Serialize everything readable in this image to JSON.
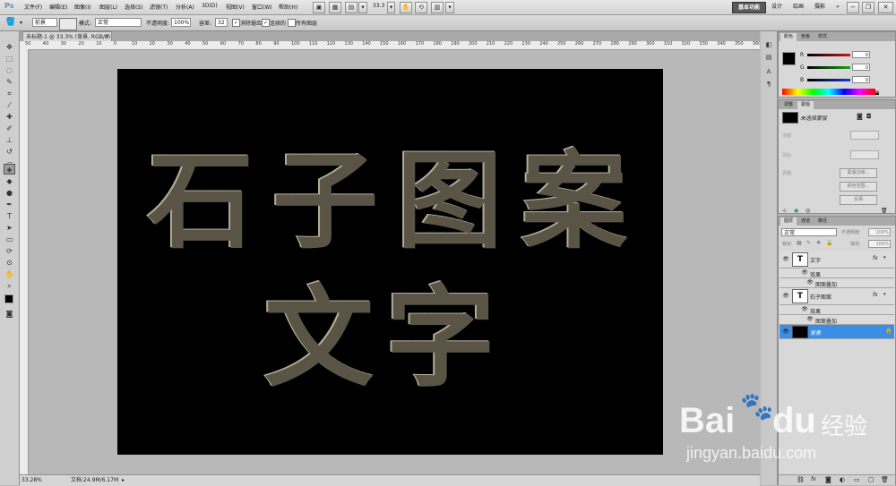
{
  "app": {
    "logo": "Ps"
  },
  "menubar": {
    "items": [
      "文件(F)",
      "编辑(E)",
      "图像(I)",
      "图层(L)",
      "选择(S)",
      "滤镜(T)",
      "分析(A)",
      "3D(D)",
      "视图(V)",
      "窗口(W)",
      "帮助(H)"
    ],
    "zoom_value": "33.3",
    "workspaces": [
      "基本功能",
      "设计",
      "绘画",
      "摄影"
    ],
    "search_expand": "»"
  },
  "options": {
    "fill_source": "前景",
    "mode_label": "模式:",
    "mode_value": "正常",
    "opacity_label": "不透明度:",
    "opacity_value": "100%",
    "tolerance_label": "容差:",
    "tolerance_value": "32",
    "antialias_label": "消除锯齿",
    "contiguous_label": "连续的",
    "all_layers_label": "所有图层"
  },
  "document": {
    "tab_title": "未标题-1 @ 33.3% (背景, RGB/8) *",
    "ruler_ticks": [
      "50",
      "40",
      "30",
      "20",
      "10",
      "0",
      "10",
      "20",
      "30",
      "40",
      "50",
      "60",
      "70",
      "80",
      "90",
      "100",
      "110",
      "120",
      "130",
      "140",
      "150",
      "160",
      "170",
      "180",
      "190",
      "200",
      "210",
      "220",
      "230",
      "240",
      "250",
      "260",
      "270",
      "280",
      "290",
      "300",
      "310",
      "320",
      "330",
      "340",
      "350",
      "360"
    ],
    "canvas_line1": [
      "石",
      "子",
      "图",
      "案"
    ],
    "canvas_line2": [
      "文",
      "字"
    ]
  },
  "status": {
    "zoom": "33.28%",
    "doc_size": "文档:24.9M/6.17M"
  },
  "color_panel": {
    "tabs": [
      "颜色",
      "色板",
      "样式"
    ],
    "channels": [
      {
        "label": "R",
        "value": "0",
        "color": "#d01818"
      },
      {
        "label": "G",
        "value": "0",
        "color": "#18a018"
      },
      {
        "label": "B",
        "value": "0",
        "color": "#1838d0"
      }
    ]
  },
  "masks_panel": {
    "tabs": [
      "调整",
      "蒙版"
    ],
    "title": "未选择蒙版",
    "density_label": "浓度:",
    "feather_label": "羽化:",
    "refine_label": "调整:",
    "buttons": [
      "蒙版边缘...",
      "颜色范围...",
      "反相"
    ]
  },
  "layers_panel": {
    "tabs": [
      "图层",
      "通道",
      "路径"
    ],
    "blend_mode": "正常",
    "opacity_label": "不透明度:",
    "opacity_value": "100%",
    "lock_label": "锁定:",
    "fill_label": "填充:",
    "fill_value": "100%",
    "layers": [
      {
        "name": "文字",
        "effects_label": "效果",
        "effect": "图案叠加"
      },
      {
        "name": "石子图案",
        "effects_label": "效果",
        "effect": "图案叠加"
      }
    ],
    "background_name": "背景",
    "colors": {
      "selected": "#3a8ee6"
    }
  },
  "watermark": {
    "brand": "Bai",
    "brand2": "du",
    "suffix": "经验",
    "url": "jingyan.baidu.com"
  }
}
